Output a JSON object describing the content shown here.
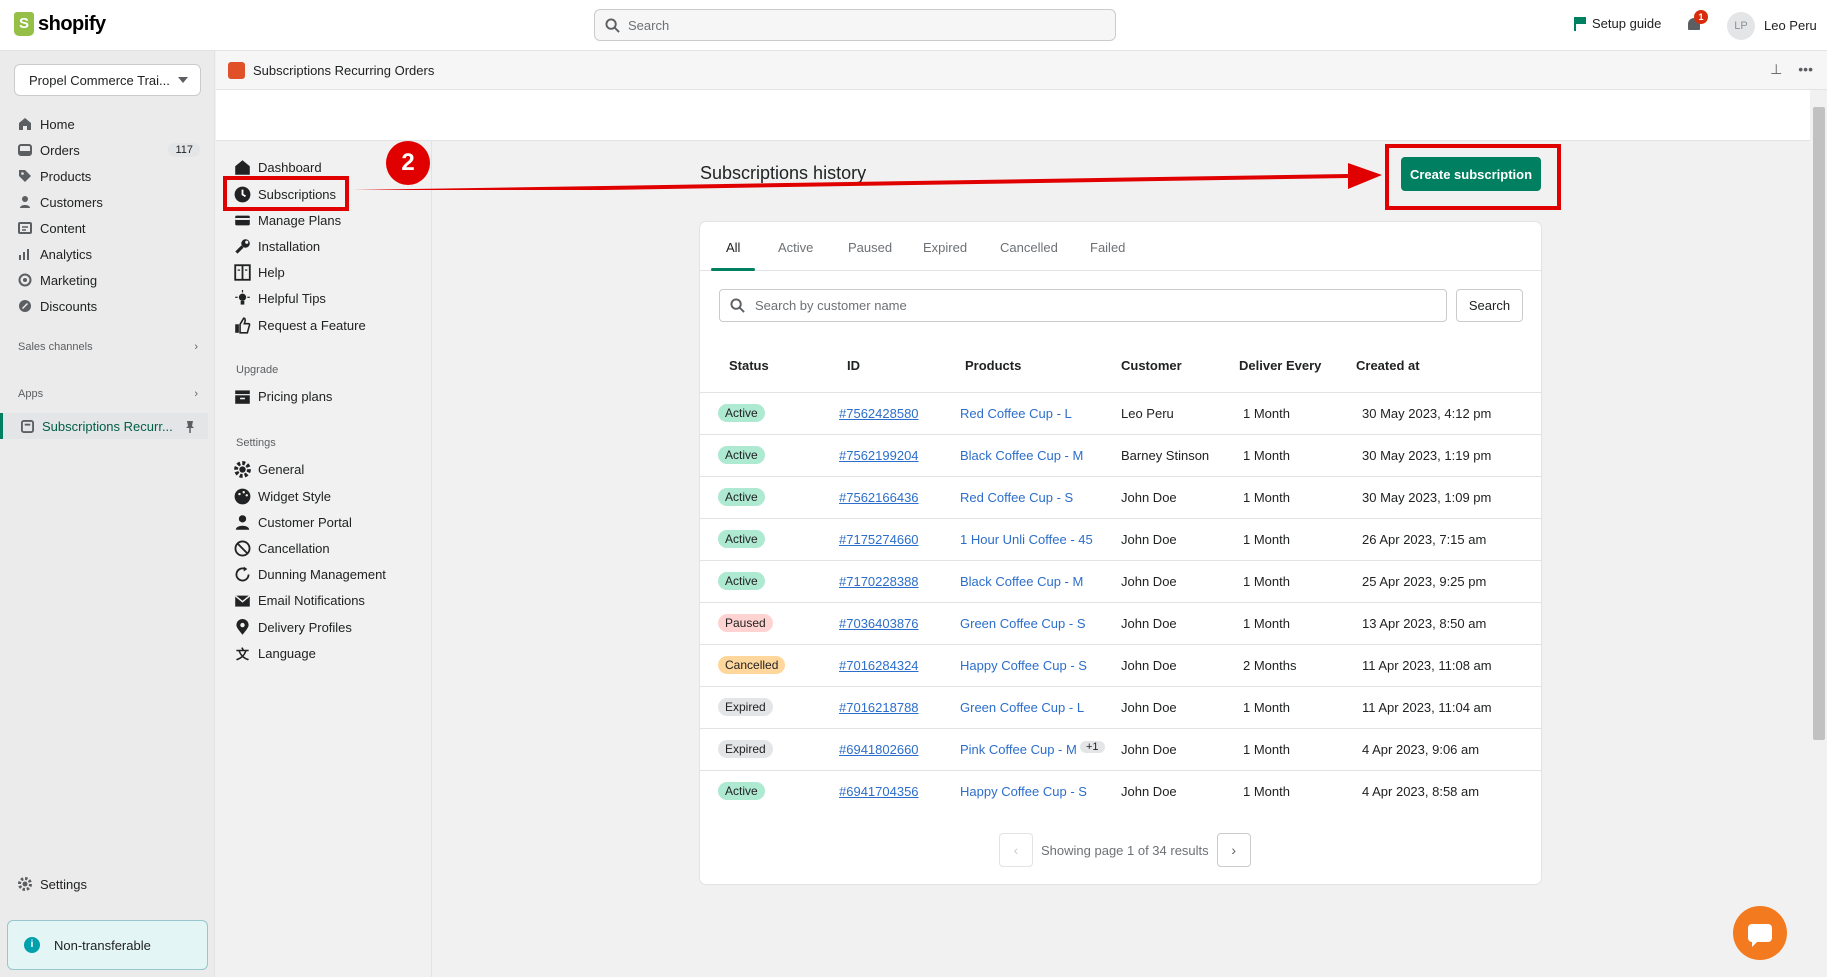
{
  "topbar": {
    "brand": "shopify",
    "search_placeholder": "Search",
    "setup_guide": "Setup guide",
    "notif_count": "1",
    "avatar_initials": "LP",
    "user_name": "Leo Peru"
  },
  "leftnav": {
    "store": "Propel Commerce Trai...",
    "items": [
      {
        "label": "Home",
        "icon": "home-icon"
      },
      {
        "label": "Orders",
        "icon": "orders-icon",
        "count": "117"
      },
      {
        "label": "Products",
        "icon": "tag-icon"
      },
      {
        "label": "Customers",
        "icon": "person-icon"
      },
      {
        "label": "Content",
        "icon": "content-icon"
      },
      {
        "label": "Analytics",
        "icon": "analytics-icon"
      },
      {
        "label": "Marketing",
        "icon": "target-icon"
      },
      {
        "label": "Discounts",
        "icon": "discount-icon"
      }
    ],
    "sales_channels": "Sales channels",
    "apps": "Apps",
    "active_app": "Subscriptions Recurr...",
    "settings": "Settings",
    "non_transferable": "Non-transferable"
  },
  "app": {
    "title": "Subscriptions Recurring Orders"
  },
  "innernav": {
    "items": [
      {
        "label": "Dashboard",
        "icon": "home-icon"
      },
      {
        "label": "Subscriptions",
        "icon": "clock-icon"
      },
      {
        "label": "Manage Plans",
        "icon": "plans-icon"
      },
      {
        "label": "Installation",
        "icon": "wrench-icon"
      },
      {
        "label": "Help",
        "icon": "book-icon"
      },
      {
        "label": "Helpful Tips",
        "icon": "lightbulb-icon"
      },
      {
        "label": "Request a Feature",
        "icon": "thumbs-up-icon"
      }
    ],
    "upgrade_label": "Upgrade",
    "upgrade_items": [
      {
        "label": "Pricing plans",
        "icon": "inbox-icon"
      }
    ],
    "settings_label": "Settings",
    "settings_items": [
      {
        "label": "General",
        "icon": "gear-icon"
      },
      {
        "label": "Widget Style",
        "icon": "palette-icon"
      },
      {
        "label": "Customer Portal",
        "icon": "person-icon"
      },
      {
        "label": "Cancellation",
        "icon": "cancel-icon"
      },
      {
        "label": "Dunning Management",
        "icon": "refresh-icon"
      },
      {
        "label": "Email Notifications",
        "icon": "email-icon"
      },
      {
        "label": "Delivery Profiles",
        "icon": "location-icon"
      },
      {
        "label": "Language",
        "icon": "translate-icon"
      }
    ]
  },
  "main": {
    "title": "Subscriptions history",
    "create_button": "Create subscription",
    "tabs": [
      "All",
      "Active",
      "Paused",
      "Expired",
      "Cancelled",
      "Failed"
    ],
    "active_tab": "All",
    "search_placeholder": "Search by customer name",
    "search_button": "Search",
    "columns": [
      "Status",
      "ID",
      "Products",
      "Customer",
      "Deliver Every",
      "Created at"
    ],
    "rows": [
      {
        "status": "Active",
        "id": "#7562428580",
        "product": "Red Coffee Cup - L",
        "customer": "Leo Peru",
        "every": "1 Month",
        "created": "30 May 2023, 4:12 pm"
      },
      {
        "status": "Active",
        "id": "#7562199204",
        "product": "Black Coffee Cup - M",
        "customer": "Barney Stinson",
        "every": "1 Month",
        "created": "30 May 2023, 1:19 pm"
      },
      {
        "status": "Active",
        "id": "#7562166436",
        "product": "Red Coffee Cup - S",
        "customer": "John Doe",
        "every": "1 Month",
        "created": "30 May 2023, 1:09 pm"
      },
      {
        "status": "Active",
        "id": "#7175274660",
        "product": "1 Hour Unli Coffee - 45",
        "customer": "John Doe",
        "every": "1 Month",
        "created": "26 Apr 2023, 7:15 am"
      },
      {
        "status": "Active",
        "id": "#7170228388",
        "product": "Black Coffee Cup - M",
        "customer": "John Doe",
        "every": "1 Month",
        "created": "25 Apr 2023, 9:25 pm"
      },
      {
        "status": "Paused",
        "id": "#7036403876",
        "product": "Green Coffee Cup - S",
        "customer": "John Doe",
        "every": "1 Month",
        "created": "13 Apr 2023, 8:50 am"
      },
      {
        "status": "Cancelled",
        "id": "#7016284324",
        "product": "Happy Coffee Cup - S",
        "customer": "John Doe",
        "every": "2 Months",
        "created": "11 Apr 2023, 11:08 am"
      },
      {
        "status": "Expired",
        "id": "#7016218788",
        "product": "Green Coffee Cup - L",
        "customer": "John Doe",
        "every": "1 Month",
        "created": "11 Apr 2023, 11:04 am"
      },
      {
        "status": "Expired",
        "id": "#6941802660",
        "product": "Pink Coffee Cup - M",
        "extra": "+1",
        "customer": "John Doe",
        "every": "1 Month",
        "created": "4 Apr 2023, 9:06 am"
      },
      {
        "status": "Active",
        "id": "#6941704356",
        "product": "Happy Coffee Cup - S",
        "customer": "John Doe",
        "every": "1 Month",
        "created": "4 Apr 2023, 8:58 am"
      }
    ],
    "pagination": "Showing page 1 of 34 results"
  },
  "annotation": {
    "step_number": "2"
  },
  "colors": {
    "primary": "#008060",
    "annotation": "#e00000",
    "link": "#2c6ecb"
  }
}
